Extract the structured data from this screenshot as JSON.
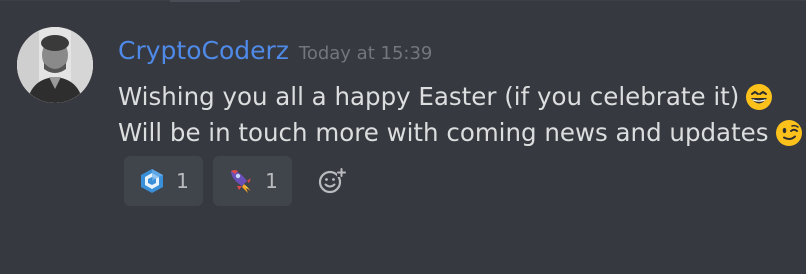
{
  "message": {
    "username": "CryptoCoderz",
    "timestamp": "Today at 15:39",
    "lines": [
      {
        "text": "Wishing you all a happy Easter (if you celebrate it)",
        "emoji": "grinning-squint-face"
      },
      {
        "text": "Will be in touch more with coming news and updates",
        "emoji": "winking-face"
      }
    ]
  },
  "reactions": [
    {
      "icon": "hexagon-logo-emoji",
      "count": "1"
    },
    {
      "icon": "rocket-emoji",
      "count": "1"
    }
  ],
  "add_reaction": {
    "icon": "add-reaction-icon"
  },
  "colors": {
    "background": "#36393f",
    "username": "#4f8ae9",
    "timestamp": "#72767d",
    "message_text": "#dcddde",
    "reaction_bg": "#40444b",
    "reaction_count": "#b9bbbe"
  }
}
